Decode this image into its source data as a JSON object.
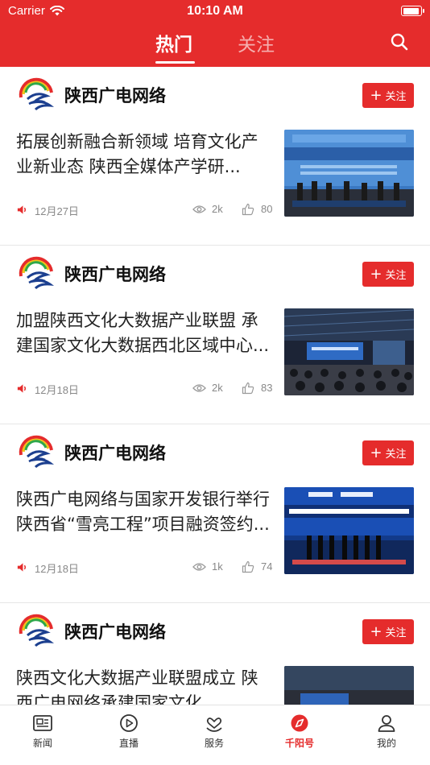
{
  "status_bar": {
    "carrier": "Carrier",
    "time": "10:10 AM"
  },
  "tabs": {
    "hot": "热门",
    "follow": "关注",
    "active": "热门"
  },
  "feed": [
    {
      "source": "陕西广电网络",
      "follow_label": "关注",
      "title": "拓展创新融合新领域 培育文化产业新业态 陕西全媒体产学研...",
      "date": "12月27日",
      "views": "2k",
      "likes": "80"
    },
    {
      "source": "陕西广电网络",
      "follow_label": "关注",
      "title": "加盟陕西文化大数据产业联盟 承建国家文化大数据西北区域中心...",
      "date": "12月18日",
      "views": "2k",
      "likes": "83"
    },
    {
      "source": "陕西广电网络",
      "follow_label": "关注",
      "title": "陕西广电网络与国家开发银行举行陕西省“雪亮工程”项目融资签约...",
      "date": "12月18日",
      "views": "1k",
      "likes": "74"
    },
    {
      "source": "陕西广电网络",
      "follow_label": "关注",
      "title": "陕西文化大数据产业联盟成立 陕西广电网络承建国家文化...",
      "date": "",
      "views": "",
      "likes": ""
    }
  ],
  "bottom_nav": [
    {
      "label": "新闻",
      "icon": "news-icon"
    },
    {
      "label": "直播",
      "icon": "live-icon"
    },
    {
      "label": "服务",
      "icon": "service-icon"
    },
    {
      "label": "千阳号",
      "icon": "compass-icon",
      "active": true
    },
    {
      "label": "我的",
      "icon": "profile-icon"
    }
  ],
  "colors": {
    "brand_red": "#e52c2c",
    "text": "#222222",
    "meta": "#888888"
  }
}
